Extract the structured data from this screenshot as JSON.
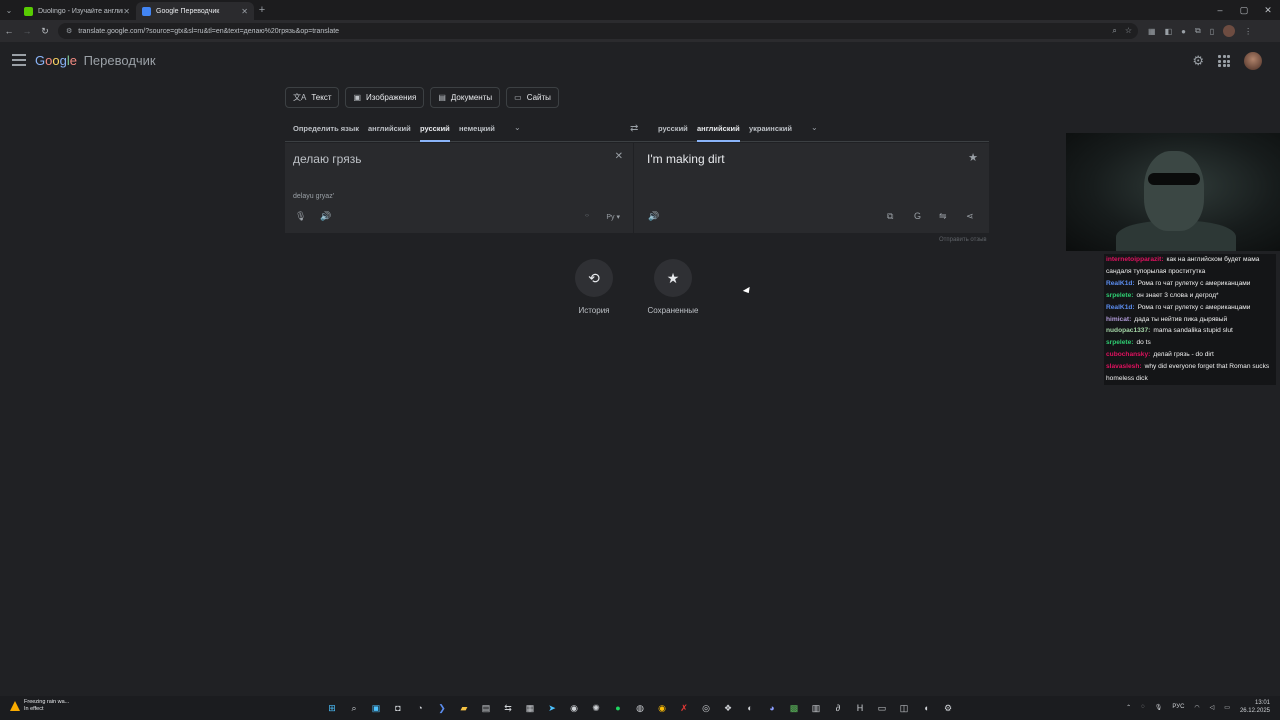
{
  "browser": {
    "tabs": [
      {
        "label": "Duolingo - Изучайте английск",
        "color": "#58cc02",
        "active": false
      },
      {
        "label": "Google Переводчик",
        "color": "#4285f4",
        "active": true
      }
    ],
    "url": "translate.google.com/?source=gtx&sl=ru&tl=en&text=делаю%20грязь&op=translate"
  },
  "header": {
    "logo_parts": [
      "G",
      "o",
      "o",
      "g",
      "l",
      "e"
    ],
    "product": "Переводчик"
  },
  "modes": [
    {
      "label": "Текст",
      "icon": "translate-icon"
    },
    {
      "label": "Изображения",
      "icon": "image-icon"
    },
    {
      "label": "Документы",
      "icon": "document-icon"
    },
    {
      "label": "Сайты",
      "icon": "website-icon"
    }
  ],
  "source_langs": {
    "detect": "Определить язык",
    "l1": "английский",
    "l2": "русский",
    "l3": "немецкий"
  },
  "target_langs": {
    "l1": "русский",
    "l2": "английский",
    "l3": "украинский"
  },
  "source": {
    "text": "делаю грязь",
    "translit": "delayu gryaz'",
    "keyboard": "Ру"
  },
  "target": {
    "text": "I'm making dirt"
  },
  "feedback": "Отправить отзыв",
  "history": {
    "history_label": "История",
    "saved_label": "Сохраненные"
  },
  "chat": [
    {
      "user": "internetoipparazit:",
      "color": "#e0115f",
      "text": "как на английском будет мама сандаля тупорылая проститутка"
    },
    {
      "user": "RealK1d:",
      "color": "#5b8def",
      "text": "Рома го чат рулетку с американцами"
    },
    {
      "user": "srpelete:",
      "color": "#2ecc71",
      "text": "он знает 3 слова и дегрод*"
    },
    {
      "user": "RealK1d:",
      "color": "#5b8def",
      "text": "Рома го чат рулетку с американцами"
    },
    {
      "user": "himicat:",
      "color": "#b39ddb",
      "text": "дада ты нейтив пика дырявый"
    },
    {
      "user": "nudopac1337:",
      "color": "#a5d6a7",
      "text": "mama sandalika stupid slut"
    },
    {
      "user": "srpelete:",
      "color": "#2ecc71",
      "text": "do ts"
    },
    {
      "user": "cubochansky:",
      "color": "#e0115f",
      "text": "делай грязь - do dirt"
    },
    {
      "user": "slavaslesh:",
      "color": "#e0115f",
      "text": "why did everyone forget that Roman sucks homeless dick"
    }
  ],
  "taskbar": {
    "weather_line1": "Freezing rain wa...",
    "weather_line2": "In effect",
    "lang": "РУС",
    "time": "13:01",
    "date": "26.12.2025"
  }
}
